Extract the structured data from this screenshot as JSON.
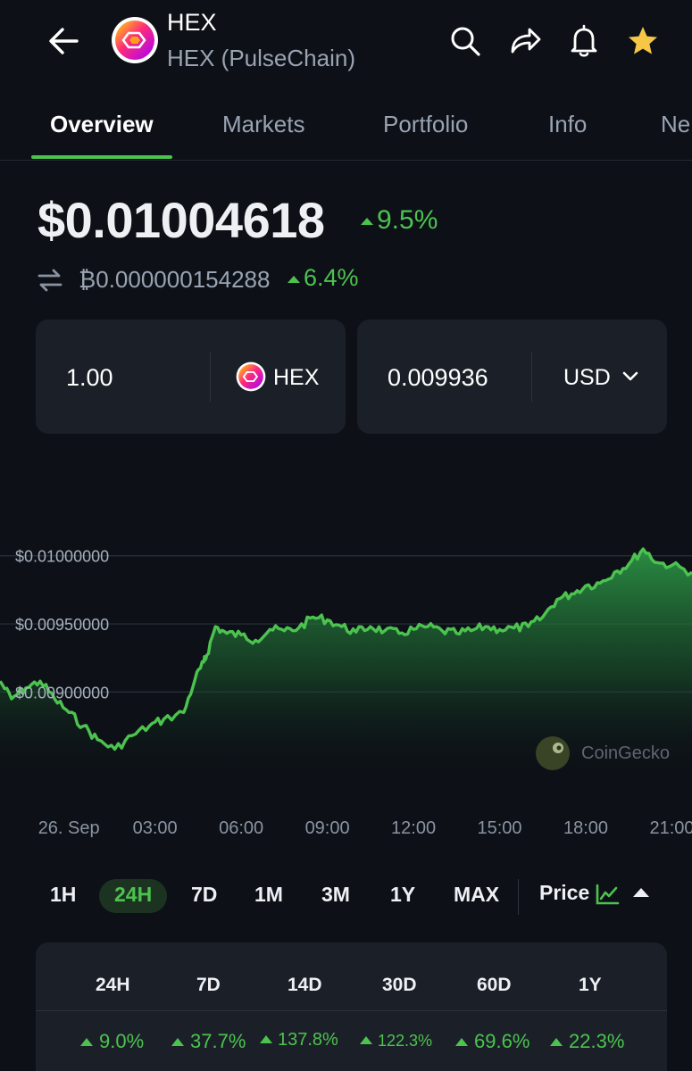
{
  "header": {
    "title": "HEX",
    "subtitle": "HEX (PulseChain)",
    "icons": [
      "back-arrow-icon",
      "search-icon",
      "share-icon",
      "bell-icon",
      "star-icon"
    ]
  },
  "tabs": [
    "Overview",
    "Markets",
    "Portfolio",
    "Info",
    "Ne"
  ],
  "price": {
    "value": "$0.01004618",
    "change": "9.5%",
    "btc_value": "₿0.000000154288",
    "btc_change": "6.4%"
  },
  "converter": {
    "amount": "1.00",
    "coin": "HEX",
    "converted": "0.009936",
    "currency": "USD"
  },
  "chart_data": {
    "type": "area",
    "y_tick_labels": [
      "$0.01000000",
      "$0.00950000",
      "$0.00900000"
    ],
    "y_ticks": [
      0.01,
      0.0095,
      0.009
    ],
    "x_tick_labels": [
      "26. Sep",
      "03:00",
      "06:00",
      "09:00",
      "12:00",
      "15:00",
      "18:00",
      "21:00"
    ],
    "x": [
      -2.4,
      -2.0,
      -1.5,
      -1.0,
      -0.5,
      0.0,
      0.5,
      1.0,
      1.6,
      2.2,
      2.8,
      3.3,
      4.0,
      4.4,
      4.7,
      4.8,
      5.1,
      5.5,
      6.0,
      6.5,
      7.0,
      7.5,
      8.0,
      8.5,
      9.0,
      9.5,
      10.0,
      10.5,
      11.0,
      11.5,
      12.0,
      12.5,
      13.0,
      13.5,
      14.0,
      14.5,
      15.0,
      15.5,
      16.0,
      16.5,
      17.0,
      17.5,
      18.0,
      18.5,
      19.0,
      19.5,
      20.0,
      20.5,
      21.0,
      21.7
    ],
    "y": [
      0.00908,
      0.00895,
      0.00903,
      0.00908,
      0.00895,
      0.00885,
      0.00875,
      0.00865,
      0.00858,
      0.00868,
      0.00875,
      0.0088,
      0.00885,
      0.0091,
      0.00922,
      0.00927,
      0.00948,
      0.00943,
      0.00942,
      0.00938,
      0.00946,
      0.00945,
      0.00947,
      0.00955,
      0.00953,
      0.00948,
      0.00944,
      0.00948,
      0.00945,
      0.00943,
      0.00946,
      0.00948,
      0.00945,
      0.00943,
      0.00945,
      0.00948,
      0.00946,
      0.00947,
      0.00948,
      0.00955,
      0.00968,
      0.00972,
      0.00978,
      0.0098,
      0.00988,
      0.00994,
      0.01005,
      0.00995,
      0.00993,
      0.00988
    ],
    "x_range": [
      -2.4,
      21.7
    ],
    "y_range": [
      0.00838,
      0.01028
    ],
    "watermark": "CoinGecko",
    "line_color": "#4cc34f",
    "grid": true
  },
  "ranges": [
    "1H",
    "24H",
    "7D",
    "1M",
    "3M",
    "1Y",
    "MAX"
  ],
  "active_range": "24H",
  "view": {
    "label": "Price",
    "icons": [
      "chart-line-icon",
      "caret-up-icon"
    ]
  },
  "performance": {
    "headers": [
      "24H",
      "7D",
      "14D",
      "30D",
      "60D",
      "1Y"
    ],
    "values": [
      "9.0%",
      "37.7%",
      "137.8%",
      "122.3%",
      "69.6%",
      "22.3%"
    ]
  },
  "colors": {
    "background": "#0d1117",
    "card": "#1b2028",
    "accent": "#4cc34f",
    "muted": "#9aa3b2",
    "star": "#f6c744"
  }
}
